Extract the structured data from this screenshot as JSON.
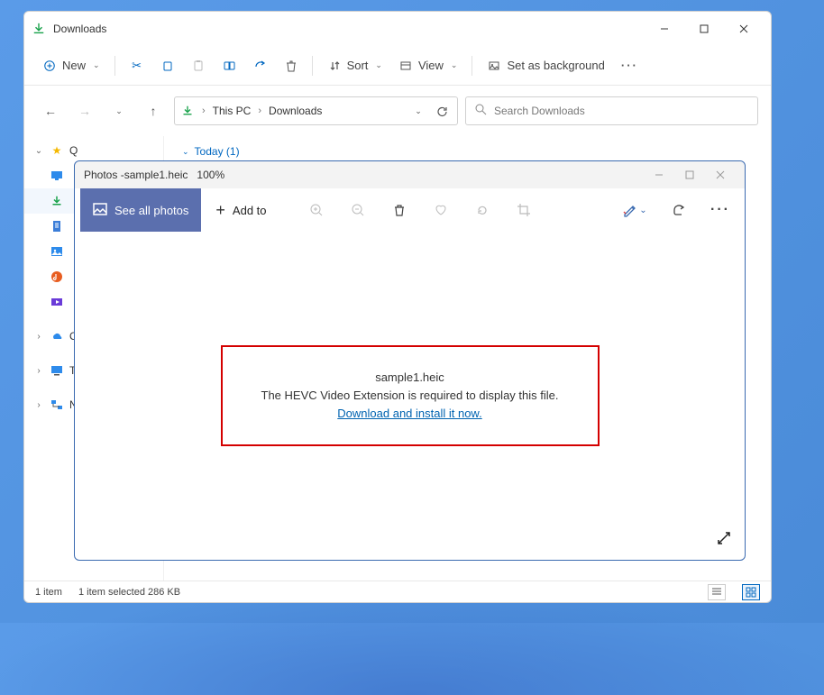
{
  "explorer": {
    "title": "Downloads",
    "toolbar": {
      "new": "New",
      "sort": "Sort",
      "view": "View",
      "set_bg": "Set as background"
    },
    "breadcrumb": {
      "root": "This PC",
      "current": "Downloads"
    },
    "search": {
      "placeholder": "Search Downloads"
    },
    "sidebar": {
      "quick": [
        {
          "label": "Q",
          "partial": true,
          "star": true
        }
      ],
      "icons": [
        {
          "name": "desktop"
        },
        {
          "name": "downloads",
          "selected": true
        },
        {
          "name": "documents"
        },
        {
          "name": "pictures"
        },
        {
          "name": "music"
        },
        {
          "name": "videos"
        }
      ],
      "groups": [
        {
          "label": "O",
          "chev": true
        },
        {
          "label": "T",
          "chev": true
        },
        {
          "label": "N",
          "chev": true
        }
      ]
    },
    "content": {
      "group_label": "Today (1)"
    },
    "status": {
      "count": "1 item",
      "selected": "1 item selected  286 KB"
    }
  },
  "photos": {
    "title_prefix": "Photos - ",
    "filename_title": "sample1.heic",
    "zoom": "100%",
    "toolbar": {
      "see_all": "See all photos",
      "add_to": "Add to"
    },
    "error": {
      "filename": "sample1.heic",
      "message": "The HEVC Video Extension is required to display this file.",
      "link": "Download and install it now."
    }
  }
}
